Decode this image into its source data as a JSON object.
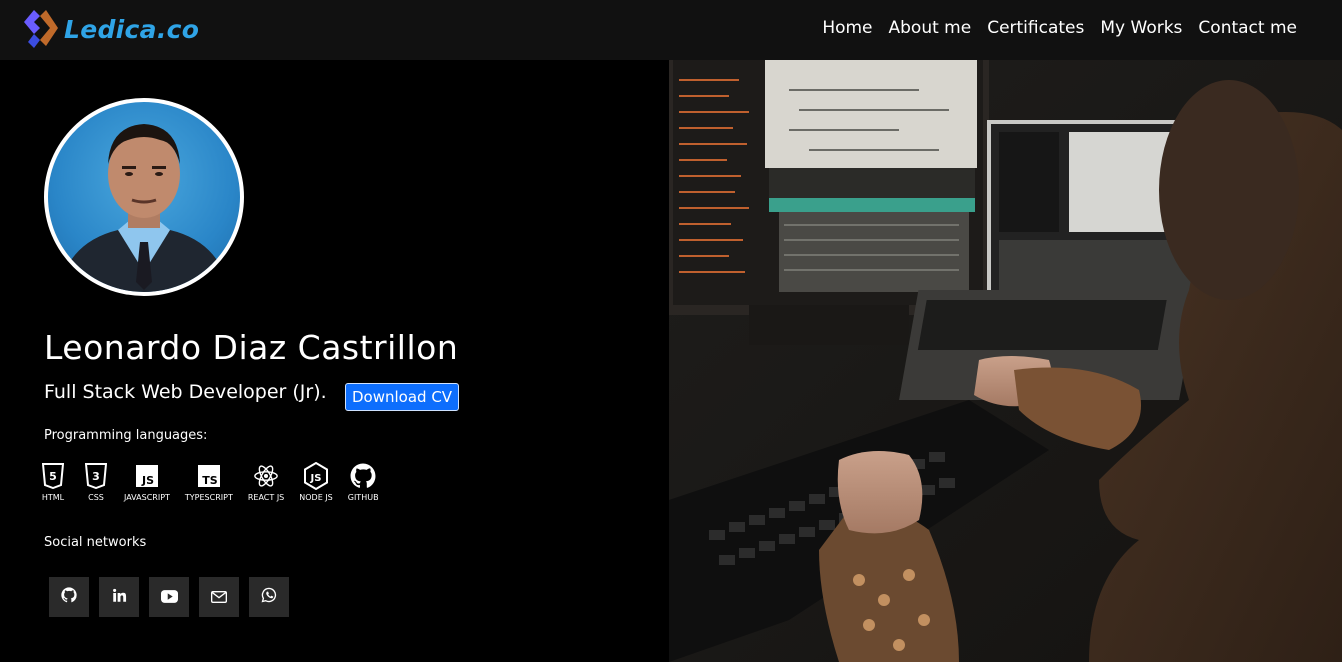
{
  "brand": {
    "name": "Ledica.co",
    "logo_icon": "chevron-logo-icon",
    "color": "#2fa4e7"
  },
  "nav": {
    "items": [
      {
        "label": "Home"
      },
      {
        "label": "About me"
      },
      {
        "label": "Certificates"
      },
      {
        "label": "My Works"
      },
      {
        "label": "Contact me"
      }
    ]
  },
  "profile": {
    "avatar": "profile-photo",
    "name": "Leonardo Diaz Castrillon",
    "role": "Full Stack Web Developer (Jr).",
    "cv_button": "Download CV",
    "accent": "#0d6efd"
  },
  "languages": {
    "title": "Programming languages:",
    "items": [
      {
        "label": "HTML",
        "icon": "html5-icon"
      },
      {
        "label": "CSS",
        "icon": "css3-icon"
      },
      {
        "label": "JAVASCRIPT",
        "icon": "javascript-icon"
      },
      {
        "label": "TYPESCRIPT",
        "icon": "typescript-icon"
      },
      {
        "label": "REACT JS",
        "icon": "react-icon"
      },
      {
        "label": "NODE JS",
        "icon": "nodejs-icon"
      },
      {
        "label": "GITHUB",
        "icon": "github-icon"
      }
    ]
  },
  "social": {
    "title": "Social networks",
    "items": [
      {
        "icon": "github-icon"
      },
      {
        "icon": "linkedin-icon"
      },
      {
        "icon": "youtube-icon"
      },
      {
        "icon": "mail-icon"
      },
      {
        "icon": "whatsapp-icon"
      }
    ]
  },
  "hero_image": "developer-at-computer-photo"
}
